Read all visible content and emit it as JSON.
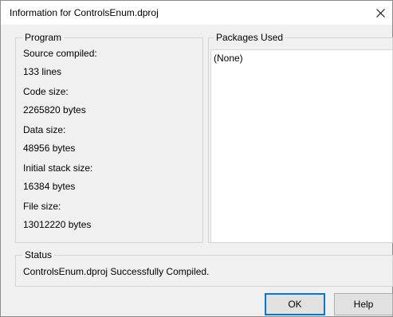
{
  "window": {
    "title": "Information for ControlsEnum.dproj",
    "close_glyph": "✕"
  },
  "program": {
    "legend": "Program",
    "items": [
      {
        "label": "Source compiled:",
        "value": "133 lines"
      },
      {
        "label": "Code size:",
        "value": "2265820 bytes"
      },
      {
        "label": "Data size:",
        "value": "48956 bytes"
      },
      {
        "label": "Initial stack size:",
        "value": "16384 bytes"
      },
      {
        "label": "File size:",
        "value": "13012220 bytes"
      }
    ]
  },
  "packages": {
    "legend": "Packages Used",
    "items": [
      "(None)"
    ]
  },
  "status": {
    "legend": "Status",
    "message": "ControlsEnum.dproj Successfully Compiled."
  },
  "buttons": {
    "ok_label": "OK",
    "help_label": "Help"
  },
  "colors": {
    "dialog_background": "#f0f0f0",
    "default_button_border": "#0078d7"
  }
}
